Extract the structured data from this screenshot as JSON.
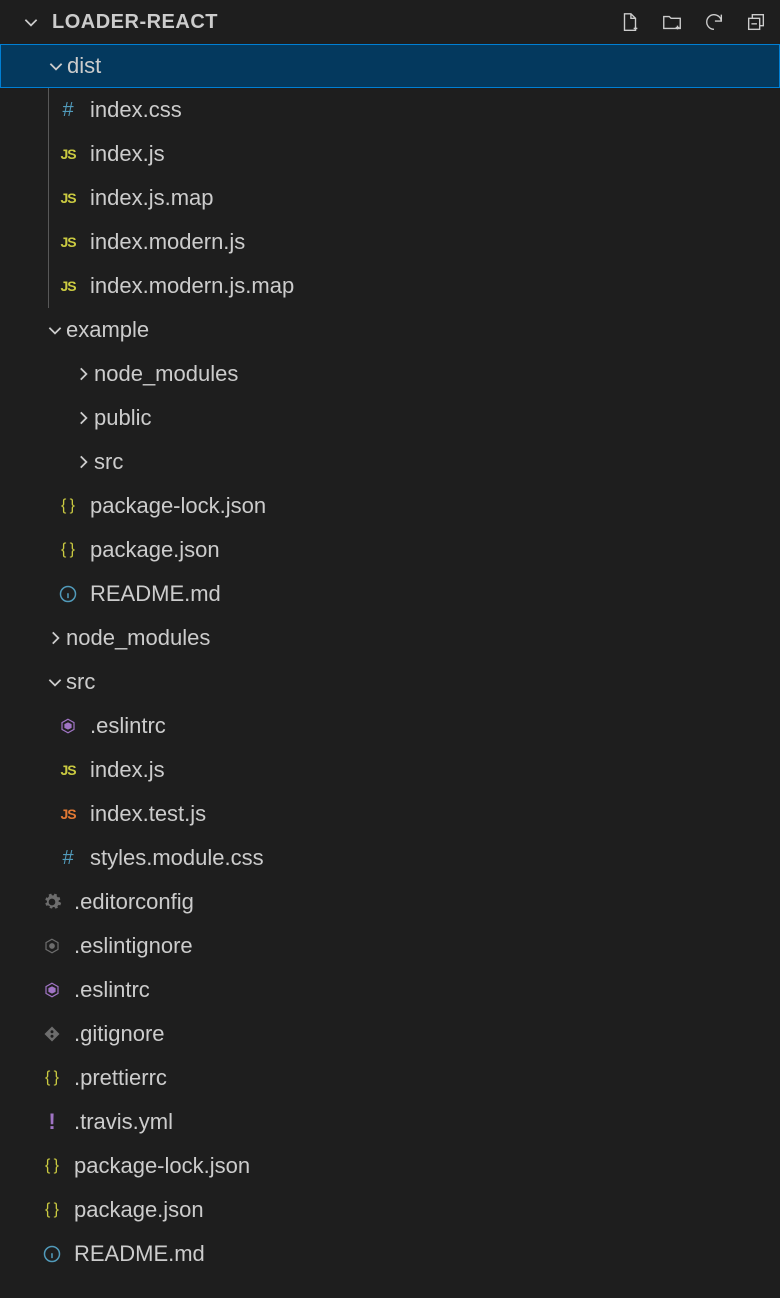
{
  "header": {
    "title": "LOADER-REACT"
  },
  "tree": {
    "dist": {
      "label": "dist",
      "files": {
        "index_css": "index.css",
        "index_js": "index.js",
        "index_js_map": "index.js.map",
        "index_modern_js": "index.modern.js",
        "index_modern_js_map": "index.modern.js.map"
      }
    },
    "example": {
      "label": "example",
      "folders": {
        "node_modules": "node_modules",
        "public": "public",
        "src": "src"
      },
      "files": {
        "package_lock": "package-lock.json",
        "package_json": "package.json",
        "readme": "README.md"
      }
    },
    "node_modules": {
      "label": "node_modules"
    },
    "src": {
      "label": "src",
      "files": {
        "eslintrc": ".eslintrc",
        "index_js": "index.js",
        "index_test_js": "index.test.js",
        "styles_module_css": "styles.module.css"
      }
    },
    "root_files": {
      "editorconfig": ".editorconfig",
      "eslintignore": ".eslintignore",
      "eslintrc": ".eslintrc",
      "gitignore": ".gitignore",
      "prettierrc": ".prettierrc",
      "travis_yml": ".travis.yml",
      "package_lock": "package-lock.json",
      "package_json": "package.json",
      "readme": "README.md"
    }
  }
}
